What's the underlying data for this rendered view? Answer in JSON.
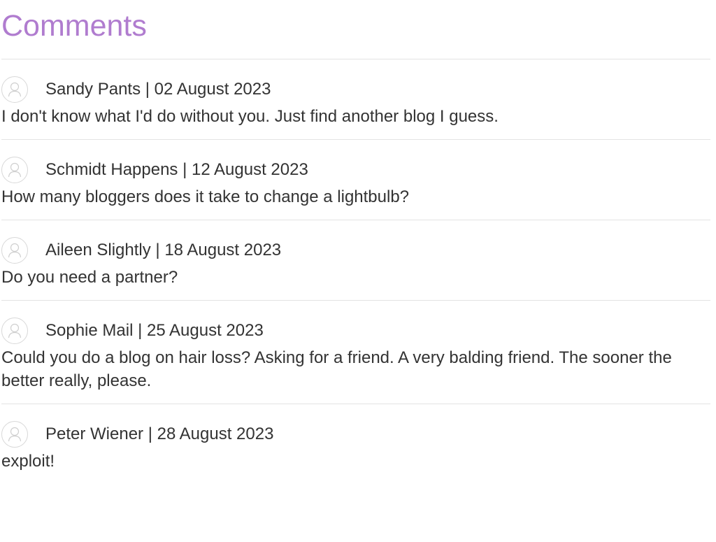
{
  "section": {
    "title": "Comments"
  },
  "comments": [
    {
      "author": "Sandy Pants",
      "date": "02 August 2023",
      "meta": "Sandy Pants | 02 August 2023",
      "text": "I don't know what I'd do without you. Just find another blog I guess.",
      "avatar_icon": "user-avatar-icon"
    },
    {
      "author": "Schmidt Happens",
      "date": "12 August 2023",
      "meta": "Schmidt Happens | 12 August 2023",
      "text": "How many bloggers does it take to change a lightbulb?",
      "avatar_icon": "user-avatar-icon"
    },
    {
      "author": "Aileen Slightly",
      "date": "18 August 2023",
      "meta": "Aileen Slightly | 18 August 2023",
      "text": "Do you need a partner?",
      "avatar_icon": "user-avatar-icon"
    },
    {
      "author": "Sophie Mail",
      "date": "25 August 2023",
      "meta": "Sophie Mail | 25 August 2023",
      "text": "Could you do a blog on hair loss? Asking for a friend. A very balding friend. The sooner the better really, please.",
      "avatar_icon": "user-avatar-icon"
    },
    {
      "author": "Peter Wiener",
      "date": "28 August 2023",
      "meta": "Peter Wiener | 28 August 2023",
      "text": "exploit!",
      "avatar_icon": "user-avatar-icon"
    }
  ],
  "colors": {
    "title": "#b07ccf",
    "text": "#333333",
    "divider": "#e3e3e3",
    "avatar_border": "#d8d8d8"
  }
}
